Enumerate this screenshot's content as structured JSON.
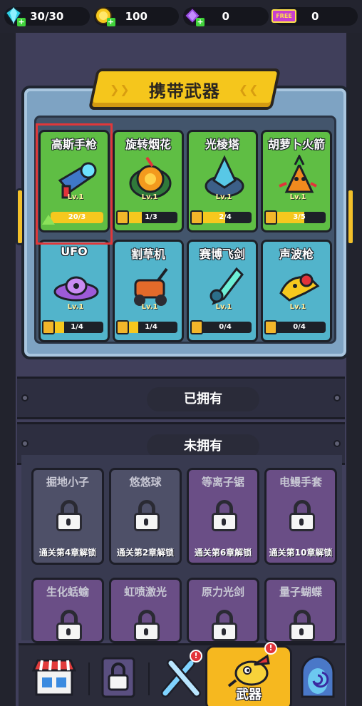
{
  "topbar": {
    "energy": "30/30",
    "coins": "100",
    "gems": "0",
    "tickets": "0",
    "free_label": "FREE"
  },
  "equip": {
    "title": "携带武器",
    "weapons": [
      {
        "name": "高斯手枪",
        "level": "Lv.1",
        "progress": "20/3",
        "fill": 1.0,
        "theme": "green",
        "upgradable": true
      },
      {
        "name": "旋转烟花",
        "level": "Lv.1",
        "progress": "1/3",
        "fill": 0.33,
        "theme": "green"
      },
      {
        "name": "光棱塔",
        "level": "Lv.1",
        "progress": "2/4",
        "fill": 0.5,
        "theme": "green"
      },
      {
        "name": "胡萝卜火箭",
        "level": "Lv.1",
        "progress": "3/5",
        "fill": 0.6,
        "theme": "green"
      },
      {
        "name": "UFO",
        "level": "Lv.1",
        "progress": "1/4",
        "fill": 0.25,
        "theme": "blue"
      },
      {
        "name": "割草机",
        "level": "Lv.1",
        "progress": "1/4",
        "fill": 0.25,
        "theme": "blue"
      },
      {
        "name": "赛博飞剑",
        "level": "Lv.1",
        "progress": "0/4",
        "fill": 0.0,
        "theme": "blue"
      },
      {
        "name": "声波枪",
        "level": "Lv.1",
        "progress": "0/4",
        "fill": 0.0,
        "theme": "blue"
      }
    ]
  },
  "owned": {
    "title": "已拥有"
  },
  "unowned": {
    "title": "未拥有",
    "weapons": [
      {
        "name": "掘地小子",
        "unlock": "通关第4章解锁",
        "theme": "gray"
      },
      {
        "name": "悠悠球",
        "unlock": "通关第2章解锁",
        "theme": "gray"
      },
      {
        "name": "等离子锯",
        "unlock": "通关第6章解锁",
        "theme": "purple"
      },
      {
        "name": "电鳗手套",
        "unlock": "通关第10章解锁",
        "theme": "purple"
      },
      {
        "name": "生化蛞蝓",
        "unlock": "",
        "theme": "purple"
      },
      {
        "name": "虹喷激光",
        "unlock": "",
        "theme": "purple"
      },
      {
        "name": "原力光剑",
        "unlock": "",
        "theme": "purple"
      },
      {
        "name": "量子蝴蝶",
        "unlock": "",
        "theme": "purple"
      }
    ]
  },
  "nav": {
    "active_label": "武器",
    "badge": "!"
  },
  "colors": {
    "accent_yellow": "#f6b81f",
    "card_green": "#5fbe44",
    "card_blue": "#52b4cb",
    "selection_red": "#e0383a"
  }
}
